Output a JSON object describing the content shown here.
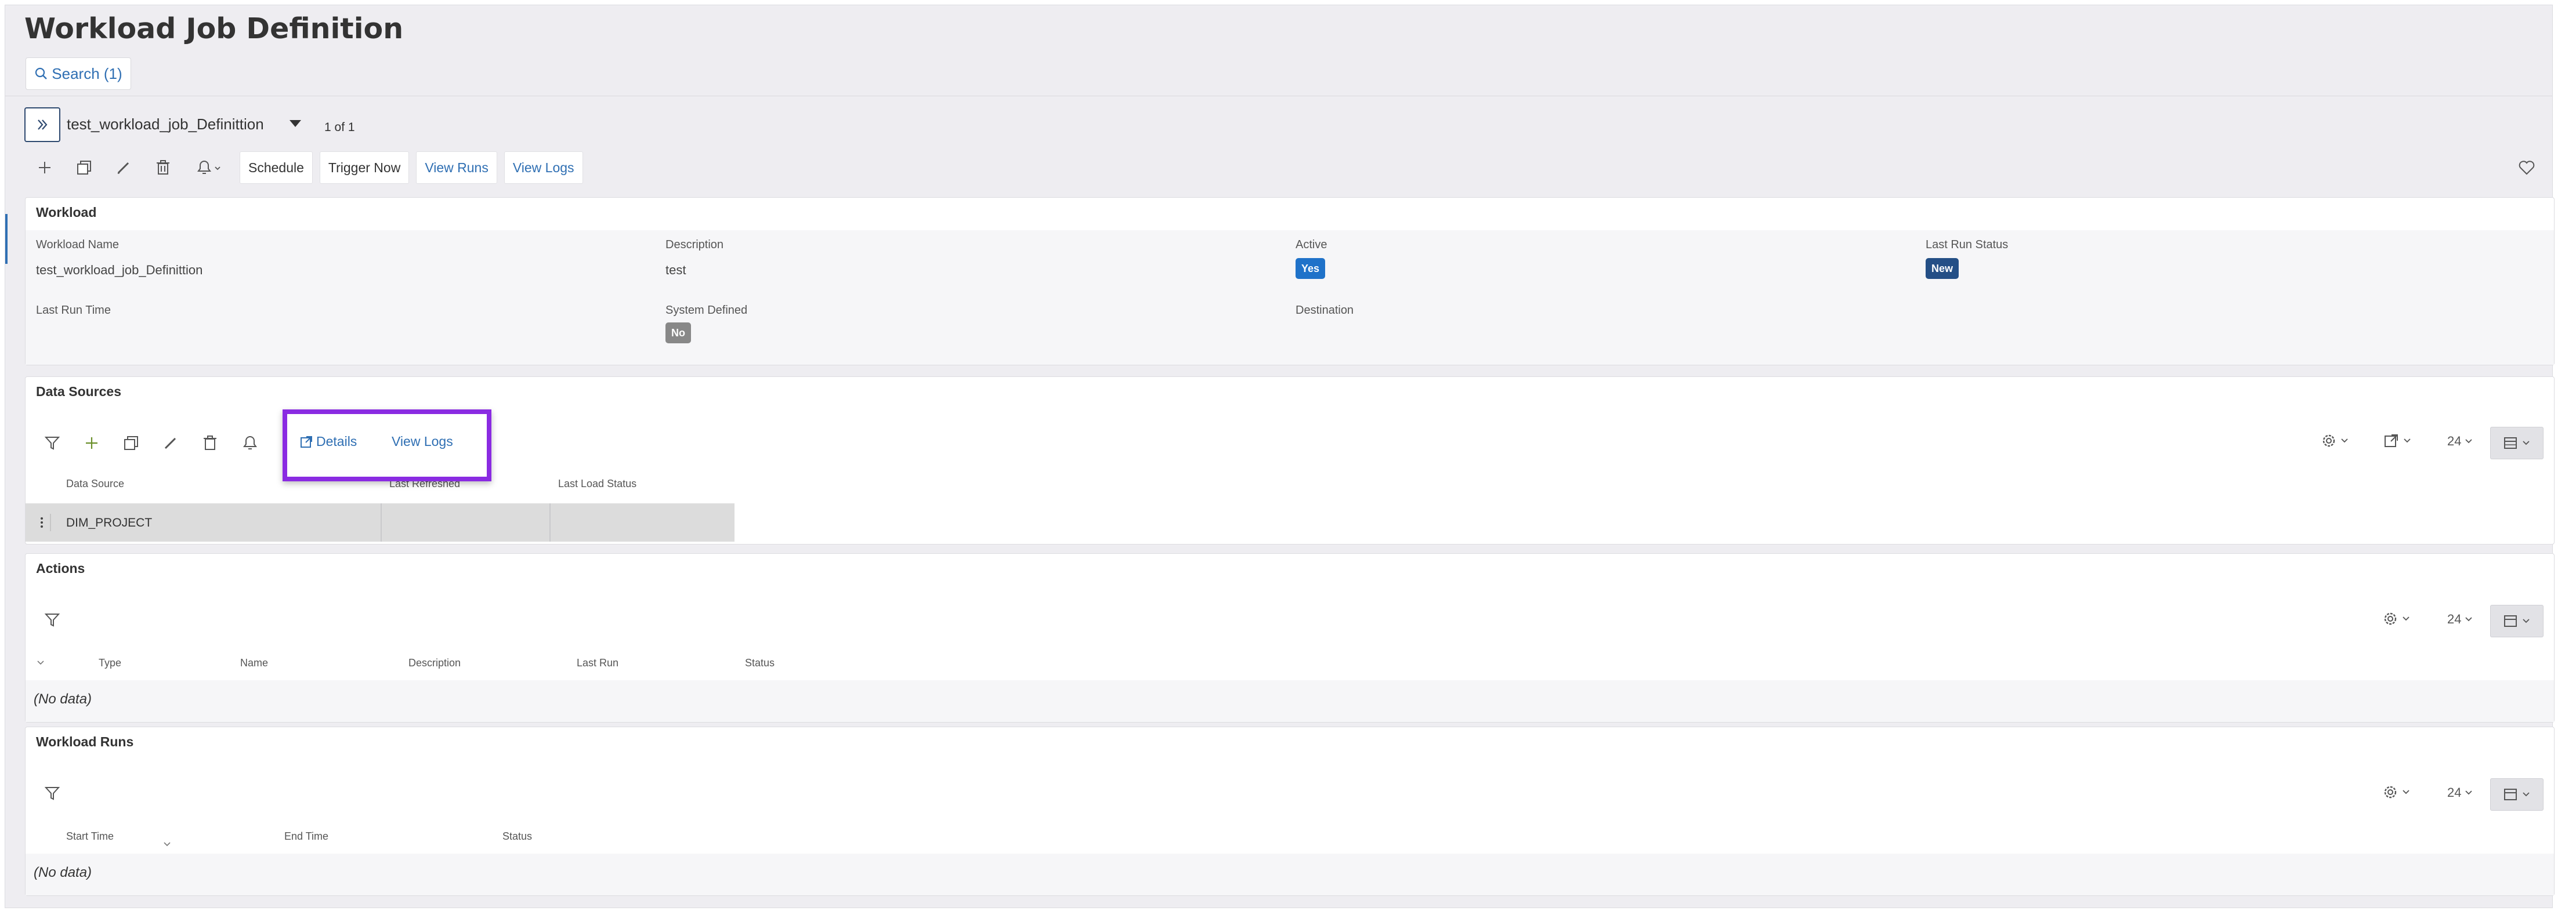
{
  "page": {
    "title": "Workload Job Definition",
    "search_label": "Search (1)"
  },
  "record": {
    "title": "test_workload_job_Definittion",
    "count": "1 of 1"
  },
  "toolbar": {
    "icons": [
      "add-icon",
      "duplicate-icon",
      "edit-icon",
      "delete-icon",
      "bell-icon"
    ],
    "buttons": [
      "Schedule",
      "Trigger Now",
      "View Runs",
      "View Logs"
    ]
  },
  "workload": {
    "title": "Workload",
    "fields": {
      "workload_name_label": "Workload Name",
      "workload_name": "test_workload_job_Definittion",
      "description_label": "Description",
      "description": "test",
      "active_label": "Active",
      "active": "Yes",
      "last_run_status_label": "Last Run Status",
      "last_run_status": "New",
      "last_run_time_label": "Last Run Time",
      "system_defined_label": "System Defined",
      "system_defined": "No",
      "destination_label": "Destination"
    },
    "colors": {
      "active_badge": "#1f72c9",
      "status_badge": "#244f86",
      "no_badge": "#888888"
    }
  },
  "data_sources": {
    "title": "Data Sources",
    "highlight_links": [
      "Details",
      "View Logs"
    ],
    "columns": [
      "Data Source",
      "Last Refreshed",
      "Last Load Status"
    ],
    "rows": [
      [
        "DIM_PROJECT",
        "",
        ""
      ]
    ],
    "page_size": "24"
  },
  "actions": {
    "title": "Actions",
    "columns": [
      "Type",
      "Name",
      "Description",
      "Last Run",
      "Status"
    ],
    "empty": "(No data)",
    "page_size": "24"
  },
  "workload_runs": {
    "title": "Workload Runs",
    "columns": [
      "Start Time",
      "End Time",
      "Status"
    ],
    "empty": "(No data)",
    "page_size": "24"
  },
  "accent": "#2f6fb3",
  "highlight_color": "#8a2be2"
}
